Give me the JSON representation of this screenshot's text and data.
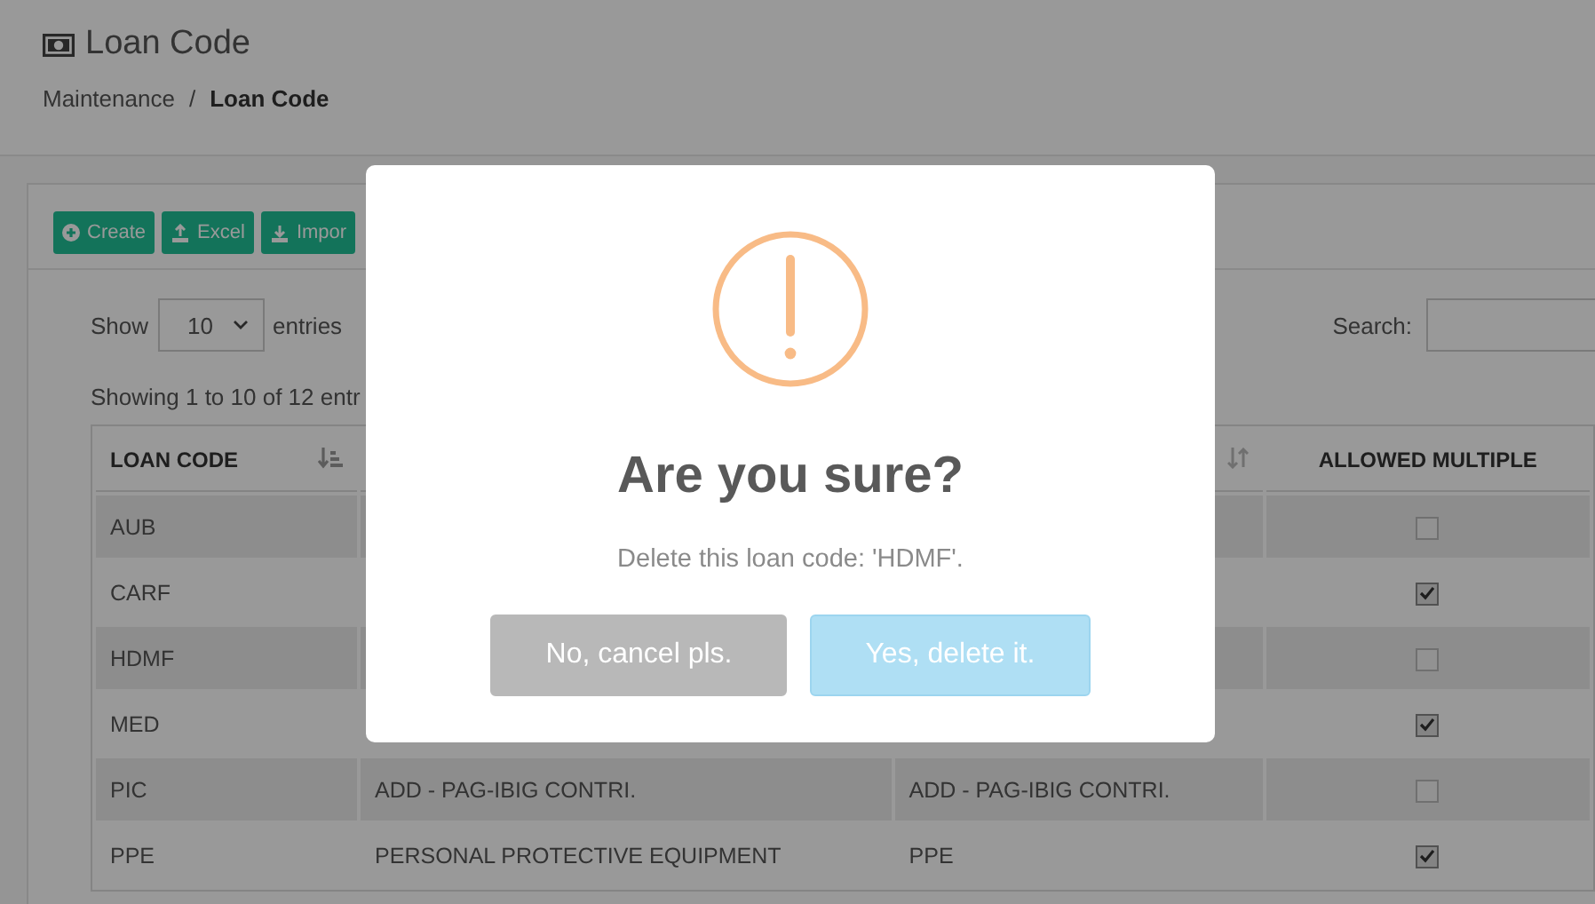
{
  "page": {
    "title": "Loan Code"
  },
  "breadcrumb": [
    {
      "label": "Maintenance",
      "current": false
    },
    {
      "label": "Loan Code",
      "current": true
    }
  ],
  "breadcrumb_separator": "/",
  "toolbar": [
    {
      "label": "Create",
      "kind": "create"
    },
    {
      "label": "Excel",
      "kind": "export"
    },
    {
      "label": "Impor",
      "kind": "import"
    }
  ],
  "length_menu": {
    "before": "Show",
    "value": "10",
    "after": "entries"
  },
  "search": {
    "label": "Search:"
  },
  "info": "Showing 1 to 10 of 12 entr",
  "table": {
    "columns": [
      {
        "label": "LOAN CODE",
        "sorted": true
      },
      null,
      {
        "sorted": false
      },
      {
        "label": "ALLOWED MULTIPLE"
      }
    ],
    "rows": [
      {
        "cells": [
          "AUB",
          null,
          null
        ],
        "checked": false
      },
      {
        "cells": [
          "CARF",
          null,
          null
        ],
        "checked": true
      },
      {
        "cells": [
          "HDMF",
          null,
          null
        ],
        "checked": false
      },
      {
        "cells": [
          "MED",
          null,
          null
        ],
        "checked": true
      },
      {
        "cells": [
          "PIC",
          "ADD - PAG-IBIG CONTRI.",
          "ADD - PAG-IBIG CONTRI."
        ],
        "checked": false
      },
      {
        "cells": [
          "PPE",
          "PERSONAL PROTECTIVE EQUIPMENT",
          "PPE"
        ],
        "checked": true
      }
    ]
  },
  "dialog": {
    "title": "Are you sure?",
    "message": "Delete this loan code: 'HDMF'.",
    "buttons": [
      {
        "label": "No, cancel pls.",
        "kind": "cancel"
      },
      {
        "label": "Yes, delete it.",
        "kind": "confirm"
      }
    ]
  }
}
